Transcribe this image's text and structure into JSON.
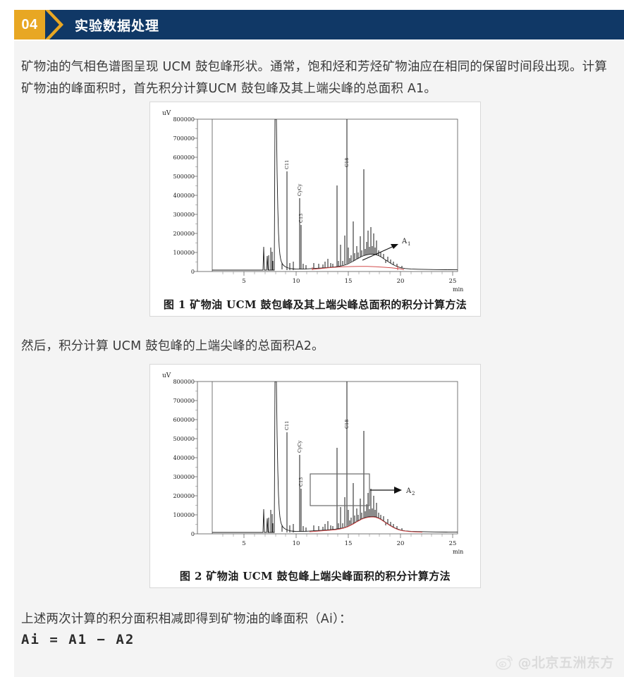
{
  "header": {
    "number": "04",
    "title": "实验数据处理",
    "band_color": "#103866",
    "number_color": "#e8a723"
  },
  "body": {
    "paragraph_1": "矿物油的气相色谱图呈现 UCM 鼓包峰形状。通常，饱和烃和芳烃矿物油应在相同的保留时间段出现。计算矿物油的峰面积时，首先积分计算UCM 鼓包峰及其上端尖峰的总面积 A1。",
    "paragraph_2": "然后，积分计算 UCM 鼓包峰的上端尖峰的总面积A2。",
    "paragraph_3": "上述两次计算的积分面积相减即得到矿物油的峰面积（Ai）：",
    "formula": "Ai = A1 − A2"
  },
  "figures": [
    {
      "id": "figure-1",
      "caption": "图 1  矿物油 UCM 鼓包峰及其上端尖峰总面积的积分计算方法",
      "annotation_label": "A₁",
      "has_box": false
    },
    {
      "id": "figure-2",
      "caption": "图 2  矿物油 UCM 鼓包峰上端尖峰面积的积分计算方法",
      "annotation_label": "A₂",
      "has_box": true
    }
  ],
  "watermark": {
    "handle": "@北京五洲东方",
    "icon": "weibo-icon"
  },
  "chart_data": [
    {
      "type": "line",
      "title": "图 1  矿物油 UCM 鼓包峰及其上端尖峰总面积的积分计算方法",
      "xlabel": "min",
      "ylabel": "uV",
      "xlim": [
        1,
        26
      ],
      "ylim": [
        0,
        800000
      ],
      "xticks": [
        5,
        10,
        15,
        20,
        25
      ],
      "yticks": [
        0,
        100000,
        200000,
        300000,
        400000,
        500000,
        600000,
        700000,
        800000
      ],
      "grid": false,
      "legend": "none",
      "series": [
        {
          "name": "chromatogram",
          "color": "#1a1a1a",
          "description": "GC-FID chromatogram of mineral oil showing solvent front at 6.4 min, resolved n-alkane marker peaks, and a UCM hump centred near 14.5 min"
        },
        {
          "name": "integration-baseline-A1",
          "color": "#d24c4c",
          "description": "Red integration baseline drawn from 11.0 min to 18.0 min along the bottom of the UCM hump, enclosing the hump plus all of its upper sharp peaks (area A1)"
        }
      ],
      "peaks": [
        {
          "label": "",
          "x": 6.4,
          "y": 800000,
          "note": "solvent front, off-scale"
        },
        {
          "label": "C11",
          "x": 7.3,
          "y": 525000
        },
        {
          "label": "CyCy",
          "x": 8.5,
          "y": 385000
        },
        {
          "label": "C13",
          "x": 8.7,
          "y": 240000
        },
        {
          "label": "",
          "x": 12.0,
          "y": 450000
        },
        {
          "label": "",
          "x": 12.2,
          "y": 150000
        },
        {
          "label": "",
          "x": 13.3,
          "y": 188000
        },
        {
          "label": "",
          "x": 14.0,
          "y": 508000
        },
        {
          "label": "",
          "x": 14.6,
          "y": 265000
        },
        {
          "label": "",
          "x": 14.9,
          "y": 180000
        },
        {
          "label": "C18",
          "x": 15.5,
          "y": 535000
        },
        {
          "label": "",
          "x": 16.1,
          "y": 245000
        },
        {
          "label": "",
          "x": 16.3,
          "y": 215000
        }
      ],
      "annotations": [
        {
          "text": "A₁",
          "type": "arrow-label",
          "x": 19.5,
          "y": 150000,
          "points_to": [
            16.0,
            65000
          ]
        }
      ]
    },
    {
      "type": "line",
      "title": "图 2  矿物油 UCM 鼓包峰上端尖峰面积的积分计算方法",
      "xlabel": "min",
      "ylabel": "uV",
      "xlim": [
        1,
        26
      ],
      "ylim": [
        0,
        800000
      ],
      "xticks": [
        5,
        10,
        15,
        20,
        25
      ],
      "yticks": [
        0,
        100000,
        200000,
        300000,
        400000,
        500000,
        600000,
        700000,
        800000
      ],
      "grid": false,
      "legend": "none",
      "series": [
        {
          "name": "chromatogram",
          "color": "#1a1a1a",
          "description": "Same GC-FID chromatogram of mineral oil as figure 1"
        },
        {
          "name": "integration-baseline-A2",
          "color": "#d24c4c",
          "description": "Red integration baseline traced along the top contour of the UCM hump itself, so only the sharp peaks rising above the hump are integrated (area A2)"
        }
      ],
      "peaks": [
        {
          "label": "",
          "x": 6.4,
          "y": 800000,
          "note": "solvent front, off-scale"
        },
        {
          "label": "C11",
          "x": 7.3,
          "y": 530000
        },
        {
          "label": "CyCy",
          "x": 8.5,
          "y": 415000
        },
        {
          "label": "C13",
          "x": 8.7,
          "y": 235000
        },
        {
          "label": "",
          "x": 12.0,
          "y": 450000
        },
        {
          "label": "",
          "x": 12.2,
          "y": 145000
        },
        {
          "label": "",
          "x": 13.3,
          "y": 190000
        },
        {
          "label": "",
          "x": 14.0,
          "y": 510000
        },
        {
          "label": "",
          "x": 14.6,
          "y": 268000
        },
        {
          "label": "",
          "x": 15.0,
          "y": 175000
        },
        {
          "label": "C18",
          "x": 15.5,
          "y": 540000
        },
        {
          "label": "",
          "x": 16.1,
          "y": 245000
        },
        {
          "label": "",
          "x": 16.4,
          "y": 210000
        }
      ],
      "annotations": [
        {
          "text": "A₂",
          "type": "arrow-label",
          "x": 19.8,
          "y": 195000,
          "points_to": [
            17.2,
            195000
          ]
        },
        {
          "text": "",
          "type": "selection-box",
          "x_range": [
            11.7,
            17.0
          ],
          "y_range": [
            120000,
            265000
          ]
        }
      ]
    }
  ]
}
